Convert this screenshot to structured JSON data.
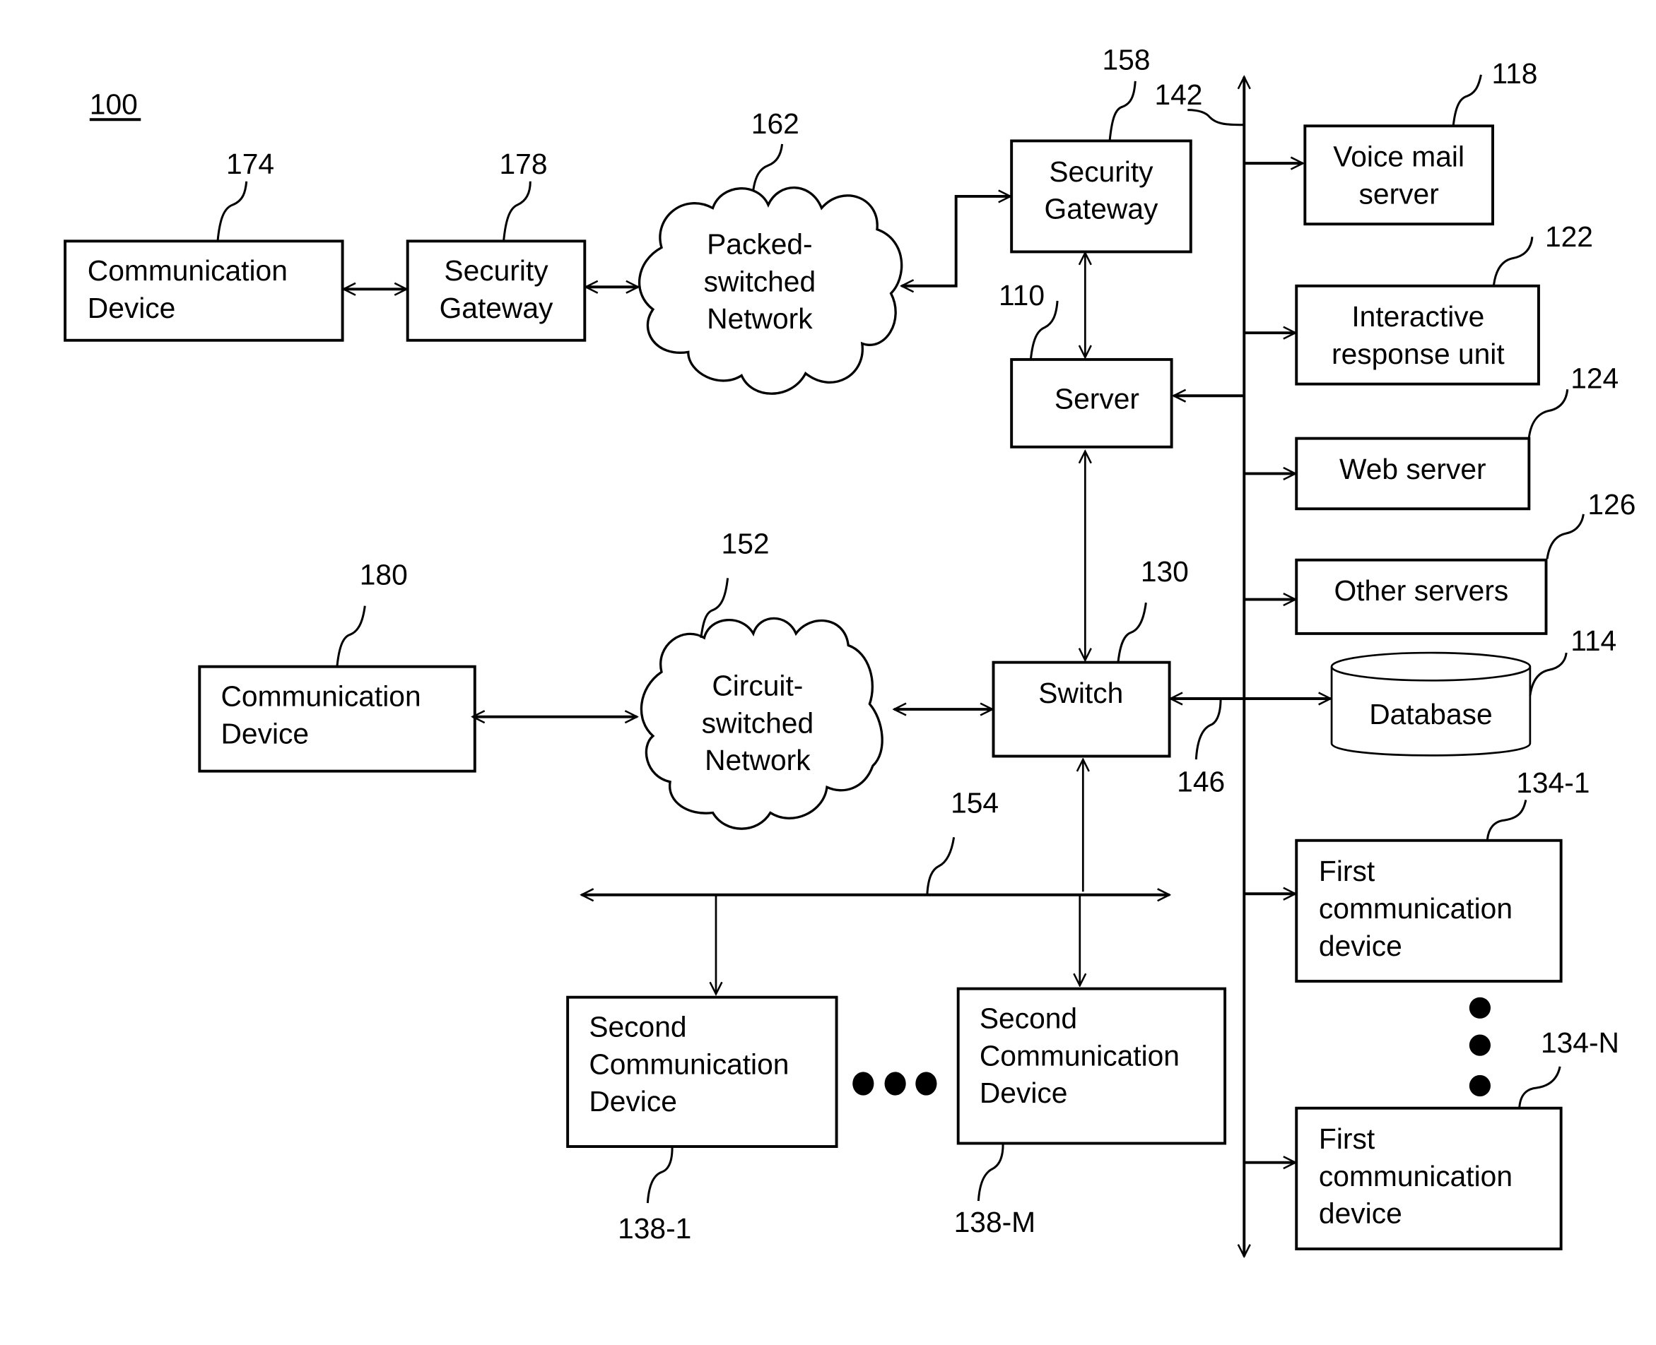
{
  "figure": {
    "number": "100",
    "bus_label": "142",
    "link_label": "146",
    "lan_label": "154"
  },
  "nodes": {
    "comm_device_174": {
      "ref": "174",
      "lines": [
        "Communication",
        "Device"
      ]
    },
    "security_gateway_178": {
      "ref": "178",
      "lines": [
        "Security",
        "Gateway"
      ]
    },
    "packet_network_162": {
      "ref": "162",
      "lines": [
        "Packed-",
        "switched",
        "Network"
      ]
    },
    "security_gateway_158": {
      "ref": "158",
      "lines": [
        "Security",
        "Gateway"
      ]
    },
    "server_110": {
      "ref": "110",
      "lines": [
        "Server"
      ]
    },
    "voice_mail_118": {
      "ref": "118",
      "lines": [
        "Voice mail",
        "server"
      ]
    },
    "ivr_122": {
      "ref": "122",
      "lines": [
        "Interactive",
        "response unit"
      ]
    },
    "web_server_124": {
      "ref": "124",
      "lines": [
        "Web server"
      ]
    },
    "other_servers_126": {
      "ref": "126",
      "lines": [
        "Other servers"
      ]
    },
    "database_114": {
      "ref": "114",
      "lines": [
        "Database"
      ]
    },
    "comm_device_180": {
      "ref": "180",
      "lines": [
        "Communication",
        "Device"
      ]
    },
    "circuit_network_152": {
      "ref": "152",
      "lines": [
        "Circuit-",
        "switched",
        "Network"
      ]
    },
    "switch_130": {
      "ref": "130",
      "lines": [
        "Switch"
      ]
    },
    "first_device_134_1": {
      "ref": "134-1",
      "lines": [
        "First",
        "communication",
        "device"
      ]
    },
    "first_device_134_n": {
      "ref": "134-N",
      "lines": [
        "First",
        "communication",
        "device"
      ]
    },
    "second_device_138_1": {
      "ref": "138-1",
      "lines": [
        "Second",
        "Communication",
        "Device"
      ]
    },
    "second_device_138_m": {
      "ref": "138-M",
      "lines": [
        "Second",
        "Communication",
        "Device"
      ]
    }
  }
}
